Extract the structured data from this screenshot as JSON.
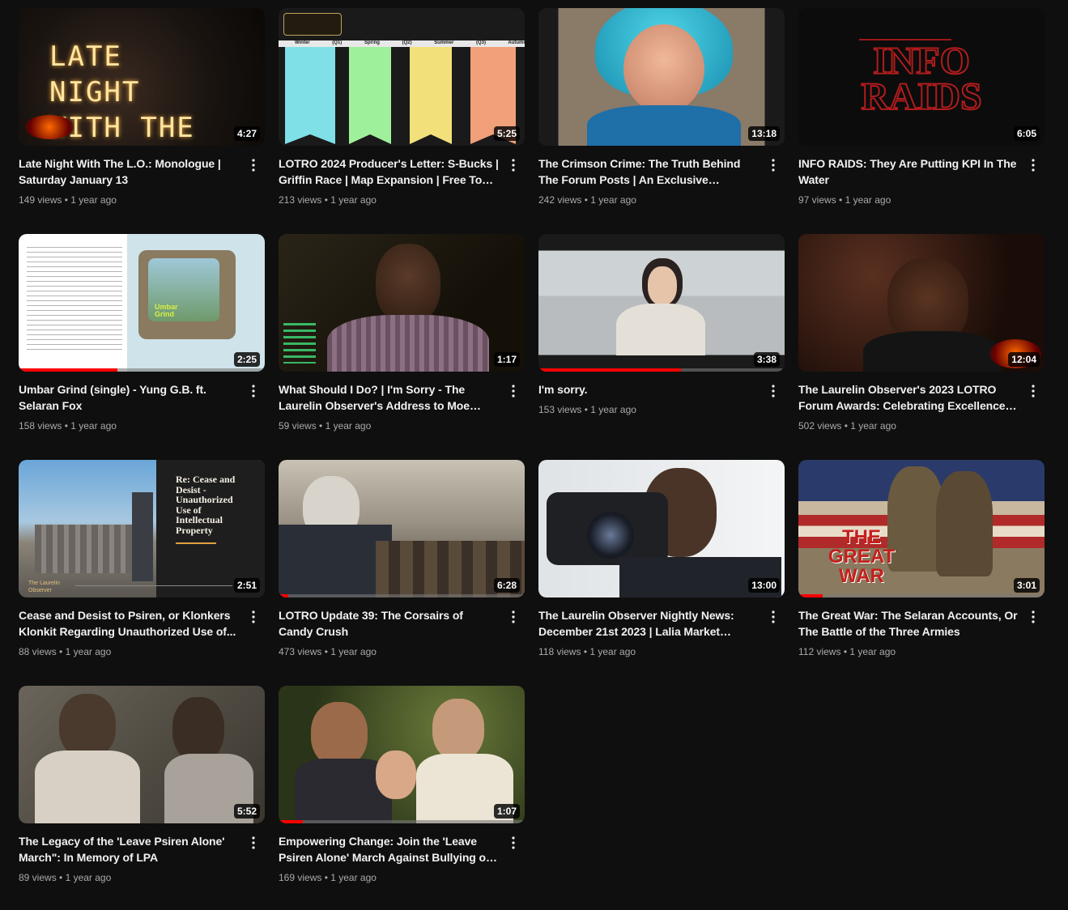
{
  "videos": [
    {
      "title": "Late Night With The L.O.: Monologue | Saturday January 13",
      "views": "149 views",
      "age": "1 year ago",
      "duration": "4:27",
      "progress": 0,
      "art_text": "LATE NIGHT WITH THE L.O."
    },
    {
      "title": "LOTRO 2024 Producer's Letter: S-Bucks | Griffin Race | Map Expansion | Free To Grin...",
      "views": "213 views",
      "age": "1 year ago",
      "duration": "5:25",
      "progress": 0,
      "art_text": "Winter (Q1)  Spring (Q2)  Summer (Q3)  Autumn (Q4)"
    },
    {
      "title": "The Crimson Crime: The Truth Behind The Forum Posts | An Exclusive Narrativization",
      "views": "242 views",
      "age": "1 year ago",
      "duration": "13:18",
      "progress": 0
    },
    {
      "title": "INFO RAIDS: They Are Putting KPI In The Water",
      "views": "97 views",
      "age": "1 year ago",
      "duration": "6:05",
      "progress": 0,
      "art_text": "INFO RAIDS"
    },
    {
      "title": "Umbar Grind (single) - Yung G.B. ft. Selaran Fox",
      "views": "158 views",
      "age": "1 year ago",
      "duration": "2:25",
      "progress": 0.4,
      "art_text": "Umbar Grind"
    },
    {
      "title": "What Should I Do? | I'm Sorry - The Laurelin Observer's Address to Moe Lester.",
      "views": "59 views",
      "age": "1 year ago",
      "duration": "1:17",
      "progress": 0
    },
    {
      "title": "I'm sorry.",
      "views": "153 views",
      "age": "1 year ago",
      "duration": "3:38",
      "progress": 0.58
    },
    {
      "title": "The Laurelin Observer's 2023 LOTRO Forum Awards: Celebrating Excellence Across...",
      "views": "502 views",
      "age": "1 year ago",
      "duration": "12:04",
      "progress": 0
    },
    {
      "title": "Cease and Desist to Psiren, or Klonkers Klonkit Regarding Unauthorized Use of...",
      "views": "88 views",
      "age": "1 year ago",
      "duration": "2:51",
      "progress": 0,
      "art_text": "Re: Cease and Desist - Unauthorized Use of Intellectual Property",
      "art_sub": "The Laurelin Observer"
    },
    {
      "title": "LOTRO Update 39: The Corsairs of Candy Crush",
      "views": "473 views",
      "age": "1 year ago",
      "duration": "6:28",
      "progress": 0.04
    },
    {
      "title": "The Laurelin Observer Nightly News: December 21st 2023 | Lalia Market Hangin...",
      "views": "118 views",
      "age": "1 year ago",
      "duration": "13:00",
      "progress": 0
    },
    {
      "title": "The Great War: The Selaran Accounts, Or The Battle of the Three Armies",
      "views": "112 views",
      "age": "1 year ago",
      "duration": "3:01",
      "progress": 0.1,
      "art_text": "THE GREAT WAR"
    },
    {
      "title": "The Legacy of the 'Leave Psiren Alone' March\": In Memory of LPA",
      "views": "89 views",
      "age": "1 year ago",
      "duration": "5:52",
      "progress": 0
    },
    {
      "title": "Empowering Change: Join the 'Leave Psiren Alone' March Against Bullying on Laurelin!...",
      "views": "169 views",
      "age": "1 year ago",
      "duration": "1:07",
      "progress": 0.1
    }
  ],
  "colors": {
    "background": "#0f0f0f",
    "title": "#f1f1f1",
    "meta": "#aaaaaa",
    "progress": "#ff0000"
  }
}
